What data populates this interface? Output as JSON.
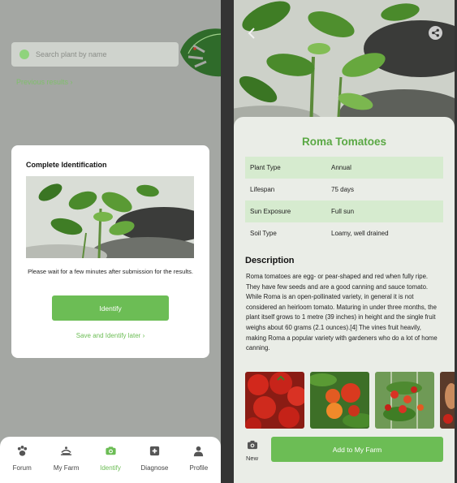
{
  "identify_screen": {
    "search": {
      "placeholder": "Search plant by name"
    },
    "previous_results_label": "Previous results",
    "modal": {
      "title": "Complete Identification",
      "message": "Please wait for a few minutes after submission for the results.",
      "identify_button": "Identify",
      "save_link": "Save and Identify later"
    },
    "nav": [
      {
        "label": "Forum",
        "icon": "paw-icon",
        "active": false
      },
      {
        "label": "My Farm",
        "icon": "farm-icon",
        "active": false
      },
      {
        "label": "Identify",
        "icon": "camera-icon",
        "active": true
      },
      {
        "label": "Diagnose",
        "icon": "plus-square-icon",
        "active": false
      },
      {
        "label": "Profile",
        "icon": "person-icon",
        "active": false
      }
    ]
  },
  "detail_screen": {
    "plant_name": "Roma Tomatoes",
    "info": [
      {
        "key": "Plant Type",
        "value": "Annual"
      },
      {
        "key": "Lifespan",
        "value": "75 days"
      },
      {
        "key": "Sun Exposure",
        "value": "Full sun"
      },
      {
        "key": "Soil Type",
        "value": "Loamy, well drained"
      }
    ],
    "description_title": "Description",
    "description": "Roma tomatoes are egg- or pear-shaped and red when fully ripe. They have few seeds and are a good canning and sauce tomato. While Roma is an open-pollinated variety, in general it is not considered an heirloom tomato. Maturing in under three months, the plant itself grows to 1 metre (39 inches) in height and the single fruit weighs about 60 grams (2.1 ounces).[4] The vines fruit heavily, making Roma a popular variety with gardeners who do a lot of home canning.",
    "new_label": "New",
    "add_button": "Add to My Farm"
  },
  "colors": {
    "accent_green": "#6cbd55",
    "title_green": "#5aa844",
    "row_shade": "#d6ebcf",
    "overlay_gray": "#a4a7a3"
  }
}
